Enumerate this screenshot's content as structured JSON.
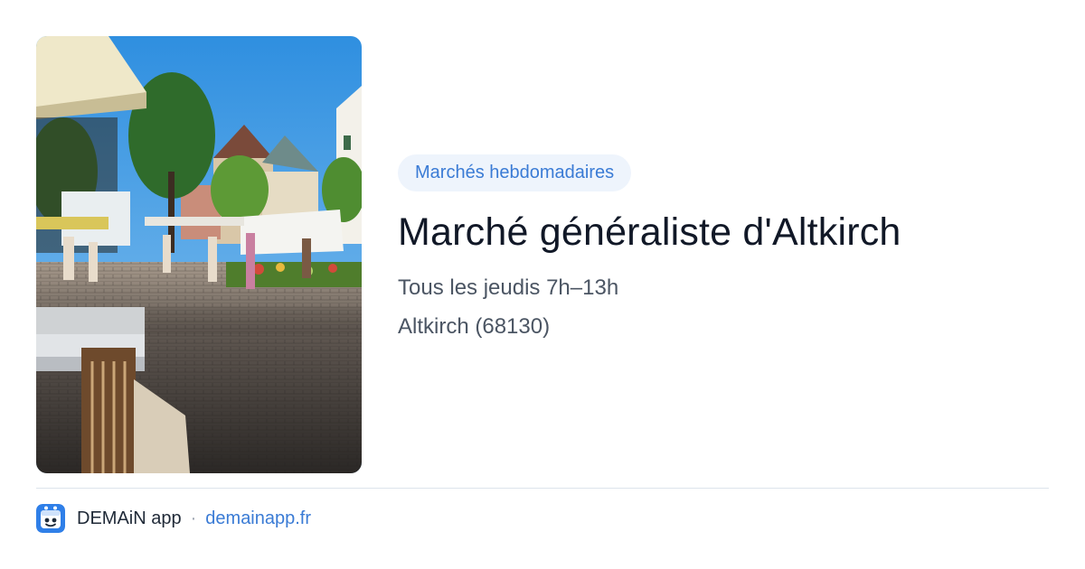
{
  "colors": {
    "accent": "#3a7bd5",
    "tag_bg": "#eef4fc",
    "title": "#111827",
    "meta": "#4b5563",
    "divider": "#dde4ec",
    "footer_text": "#1f2937",
    "sep": "#9ca3af"
  },
  "photo": {
    "subject": "outdoor weekly market on a cobblestone square with stalls, trees and townhouses"
  },
  "card": {
    "category_tag": "Marchés hebdomadaires",
    "title": "Marché généraliste d'Altkirch",
    "schedule": "Tous les jeudis 7h–13h",
    "location": "Altkirch (68130)"
  },
  "footer": {
    "app_icon": "demain-app-icon",
    "app_name": "DEMAiN app",
    "separator": "·",
    "url": "demainapp.fr"
  }
}
